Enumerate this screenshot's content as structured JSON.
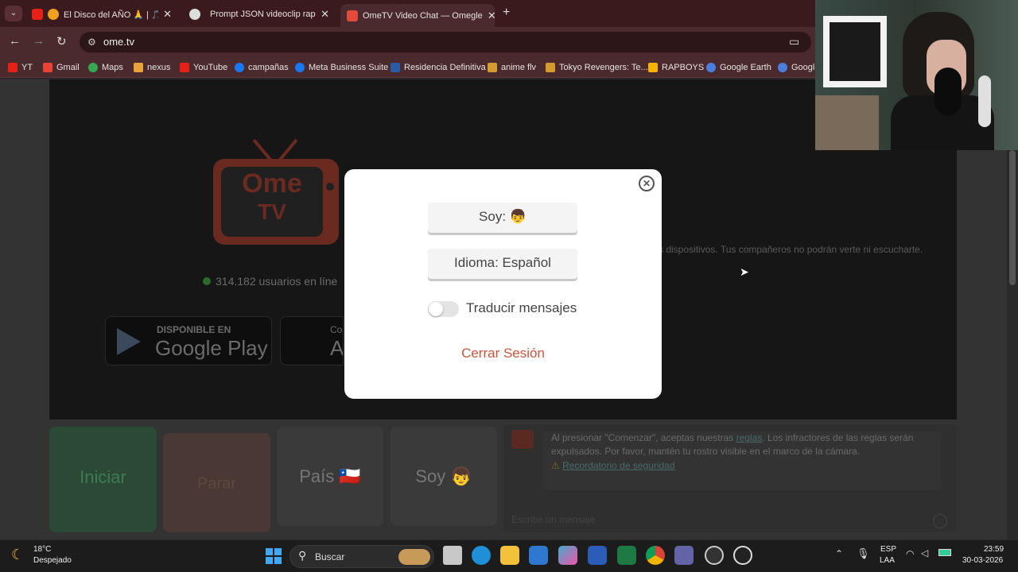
{
  "tabs": [
    {
      "label": "El Disco del AÑO 🙏 | 🎵 🔊",
      "active": false
    },
    {
      "label": "Prompt JSON videoclip rap",
      "active": false
    },
    {
      "label": "OmeTV Video Chat — Omegle",
      "active": true
    }
  ],
  "url": "ome.tv",
  "bookmarks": [
    "YT",
    "Gmail",
    "Maps",
    "nexus",
    "YouTube",
    "campañas",
    "Meta Business Suite",
    "Residencia Definitiva",
    "anime flv",
    "Tokyo Revengers: Te...",
    "RAPBOYS",
    "Google Earth",
    "Google"
  ],
  "page": {
    "logo_top": "Ome",
    "logo_bottom": "TV",
    "online_count": "314.182 usuarios en líne",
    "store_google_small": "DISPONIBLE EN",
    "store_google_big": "Google Play",
    "store_apple_small": "Co",
    "store_apple_big": "A",
    "camera_notice": "s dispositivos. Tus compañeros no podrán verte ni escucharte.",
    "buttons": {
      "start": "Iniciar",
      "stop": "Parar",
      "country": "País 🇨🇱",
      "iam": "Soy 👦"
    },
    "chat_notice": "Al presionar \"Comenzar\", aceptas nuestras",
    "chat_rules_link": "reglas",
    "chat_notice_rest": ". Los infractores de las reglas serán expulsados. Por favor, mantén tu rostro visible en el marco de la cámara.",
    "security_link": "Recordatorio de seguridad",
    "message_placeholder": "Escribe un mensaje"
  },
  "modal": {
    "iam_label": "Soy: 👦",
    "language_label": "Idioma: Español",
    "translate_label": "Traducir mensajes",
    "translate_on": false,
    "logout_label": "Cerrar Sesión"
  },
  "taskbar": {
    "temp": "18°C",
    "weather": "Despejado",
    "search": "Buscar",
    "lang_top": "ESP",
    "lang_bottom": "LAA",
    "time": "23:59",
    "date": "30-03-2026"
  }
}
